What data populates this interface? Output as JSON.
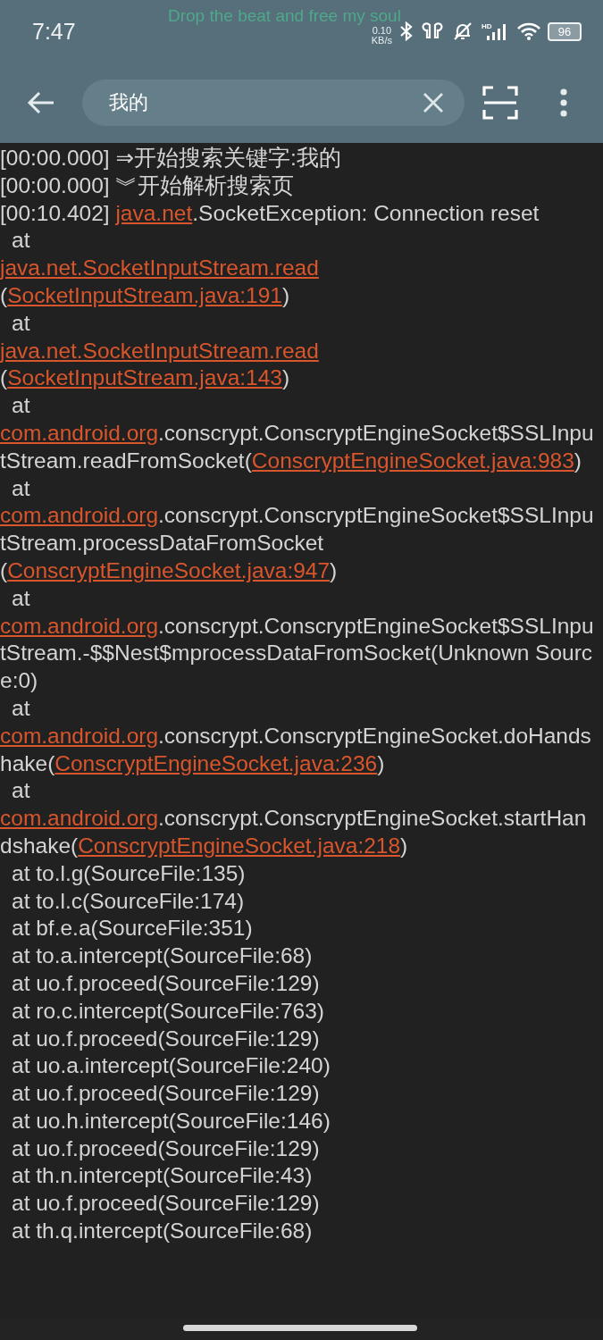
{
  "status_bar": {
    "time": "7:47",
    "lyric": "Drop the beat and free my soul",
    "net_speed": "0.10",
    "net_unit": "KB/s",
    "signal_label": "HD",
    "battery": "96"
  },
  "toolbar": {
    "search": {
      "value": "我的"
    }
  },
  "log": [
    {
      "kind": "plain",
      "segments": [
        {
          "kind": "text",
          "text": "[00:00.000] ⇒开始搜索关键字:我的"
        }
      ]
    },
    {
      "kind": "plain",
      "segments": [
        {
          "kind": "text",
          "text": "[00:00.000] ︾开始解析搜索页"
        }
      ]
    },
    {
      "kind": "plain",
      "segments": [
        {
          "kind": "text",
          "text": "[00:10.402] "
        },
        {
          "kind": "link",
          "text": "java.net"
        },
        {
          "kind": "text",
          "text": ".SocketException: Connection reset"
        }
      ]
    },
    {
      "kind": "indented",
      "segments": [
        {
          "kind": "text",
          "text": "at"
        }
      ]
    },
    {
      "kind": "plain",
      "segments": [
        {
          "kind": "link",
          "text": "java.net.SocketInputStream.read"
        },
        {
          "kind": "text",
          "text": "("
        },
        {
          "kind": "link",
          "text": "SocketInputStream.java:191"
        },
        {
          "kind": "text",
          "text": ")"
        }
      ]
    },
    {
      "kind": "indented",
      "segments": [
        {
          "kind": "text",
          "text": "at"
        }
      ]
    },
    {
      "kind": "plain",
      "segments": [
        {
          "kind": "link",
          "text": "java.net.SocketInputStream.read"
        },
        {
          "kind": "text",
          "text": "("
        },
        {
          "kind": "link",
          "text": "SocketInputStream.java:143"
        },
        {
          "kind": "text",
          "text": ")"
        }
      ]
    },
    {
      "kind": "indented",
      "segments": [
        {
          "kind": "text",
          "text": "at"
        }
      ]
    },
    {
      "kind": "plain",
      "segments": [
        {
          "kind": "link",
          "text": "com.android.org"
        },
        {
          "kind": "text",
          "text": ".conscrypt.ConscryptEngineSocket$SSLInputStream.readFromSocket("
        },
        {
          "kind": "link",
          "text": "ConscryptEngineSocket.java:983"
        },
        {
          "kind": "text",
          "text": ")"
        }
      ]
    },
    {
      "kind": "indented",
      "segments": [
        {
          "kind": "text",
          "text": "at"
        }
      ]
    },
    {
      "kind": "plain",
      "segments": [
        {
          "kind": "link",
          "text": "com.android.org"
        },
        {
          "kind": "text",
          "text": ".conscrypt.ConscryptEngineSocket$SSLInputStream.processDataFromSocket("
        },
        {
          "kind": "link",
          "text": "ConscryptEngineSocket.java:947"
        },
        {
          "kind": "text",
          "text": ")"
        }
      ]
    },
    {
      "kind": "indented",
      "segments": [
        {
          "kind": "text",
          "text": "at"
        }
      ]
    },
    {
      "kind": "plain",
      "segments": [
        {
          "kind": "link",
          "text": "com.android.org"
        },
        {
          "kind": "text",
          "text": ".conscrypt.ConscryptEngineSocket$SSLInputStream.-$$Nest$mprocessDataFromSocket(Unknown Source:0)"
        }
      ]
    },
    {
      "kind": "indented",
      "segments": [
        {
          "kind": "text",
          "text": "at"
        }
      ]
    },
    {
      "kind": "plain",
      "segments": [
        {
          "kind": "link",
          "text": "com.android.org"
        },
        {
          "kind": "text",
          "text": ".conscrypt.ConscryptEngineSocket.doHandshake("
        },
        {
          "kind": "link",
          "text": "ConscryptEngineSocket.java:236"
        },
        {
          "kind": "text",
          "text": ")"
        }
      ]
    },
    {
      "kind": "indented",
      "segments": [
        {
          "kind": "text",
          "text": "at"
        }
      ]
    },
    {
      "kind": "plain",
      "segments": [
        {
          "kind": "link",
          "text": "com.android.org"
        },
        {
          "kind": "text",
          "text": ".conscrypt.ConscryptEngineSocket.startHandshake("
        },
        {
          "kind": "link",
          "text": "ConscryptEngineSocket.java:218"
        },
        {
          "kind": "text",
          "text": ")"
        }
      ]
    },
    {
      "kind": "indented",
      "segments": [
        {
          "kind": "text",
          "text": "at to.l.g(SourceFile:135)"
        }
      ]
    },
    {
      "kind": "indented",
      "segments": [
        {
          "kind": "text",
          "text": "at to.l.c(SourceFile:174)"
        }
      ]
    },
    {
      "kind": "indented",
      "segments": [
        {
          "kind": "text",
          "text": "at bf.e.a(SourceFile:351)"
        }
      ]
    },
    {
      "kind": "indented",
      "segments": [
        {
          "kind": "text",
          "text": "at to.a.intercept(SourceFile:68)"
        }
      ]
    },
    {
      "kind": "indented",
      "segments": [
        {
          "kind": "text",
          "text": "at uo.f.proceed(SourceFile:129)"
        }
      ]
    },
    {
      "kind": "indented",
      "segments": [
        {
          "kind": "text",
          "text": "at ro.c.intercept(SourceFile:763)"
        }
      ]
    },
    {
      "kind": "indented",
      "segments": [
        {
          "kind": "text",
          "text": "at uo.f.proceed(SourceFile:129)"
        }
      ]
    },
    {
      "kind": "indented",
      "segments": [
        {
          "kind": "text",
          "text": "at uo.a.intercept(SourceFile:240)"
        }
      ]
    },
    {
      "kind": "indented",
      "segments": [
        {
          "kind": "text",
          "text": "at uo.f.proceed(SourceFile:129)"
        }
      ]
    },
    {
      "kind": "indented",
      "segments": [
        {
          "kind": "text",
          "text": "at uo.h.intercept(SourceFile:146)"
        }
      ]
    },
    {
      "kind": "indented",
      "segments": [
        {
          "kind": "text",
          "text": "at uo.f.proceed(SourceFile:129)"
        }
      ]
    },
    {
      "kind": "indented",
      "segments": [
        {
          "kind": "text",
          "text": "at th.n.intercept(SourceFile:43)"
        }
      ]
    },
    {
      "kind": "indented",
      "segments": [
        {
          "kind": "text",
          "text": "at uo.f.proceed(SourceFile:129)"
        }
      ]
    },
    {
      "kind": "indented",
      "segments": [
        {
          "kind": "text",
          "text": "at th.q.intercept(SourceFile:68)"
        }
      ]
    }
  ]
}
